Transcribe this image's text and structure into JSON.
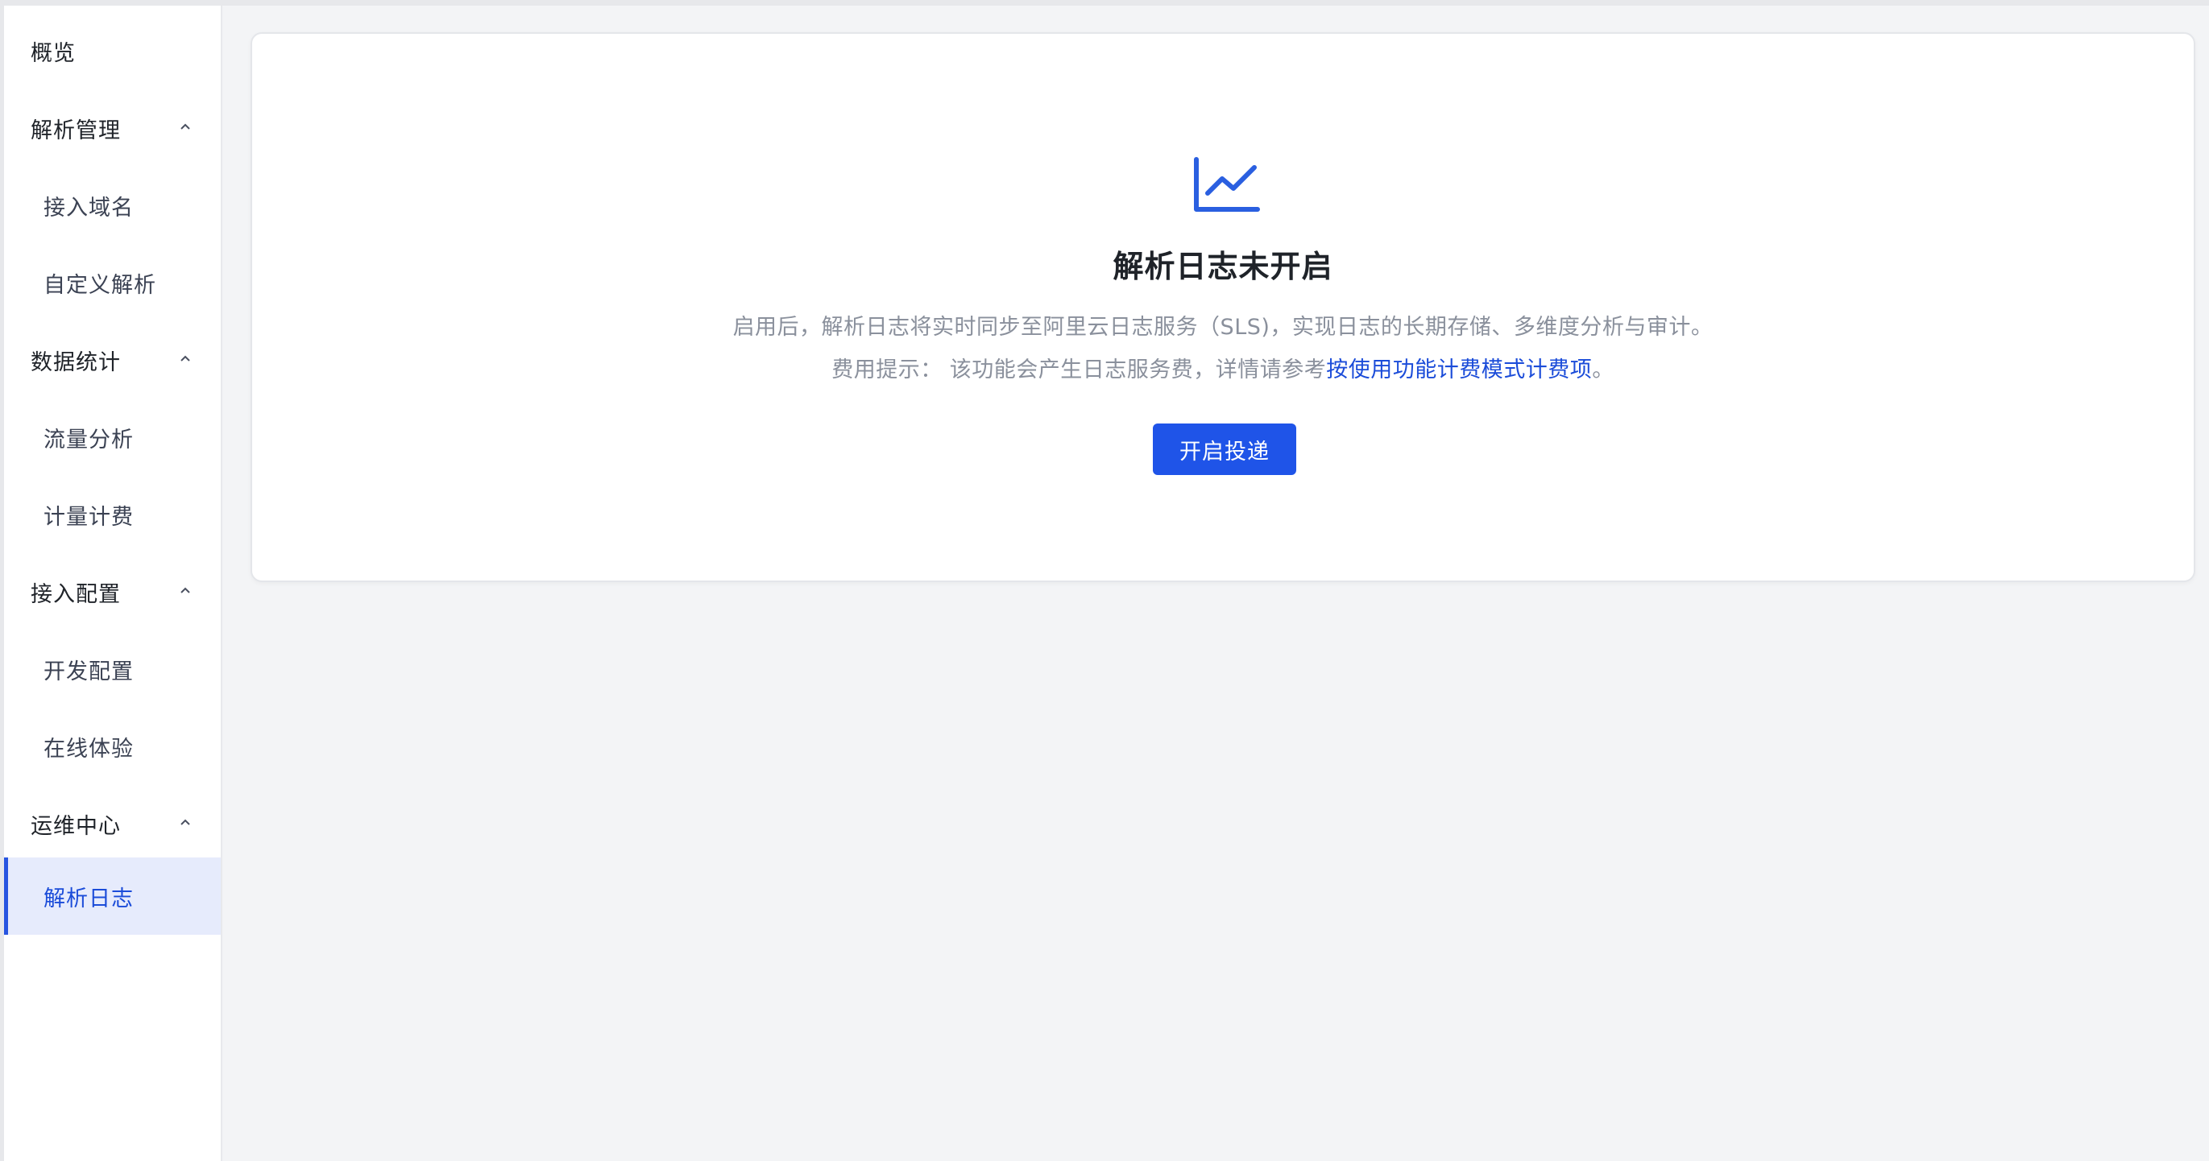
{
  "sidebar": {
    "items": [
      {
        "label": "概览",
        "type": "group",
        "has_chevron": false
      },
      {
        "label": "解析管理",
        "type": "group",
        "has_chevron": true
      },
      {
        "label": "接入域名",
        "type": "sub"
      },
      {
        "label": "自定义解析",
        "type": "sub"
      },
      {
        "label": "数据统计",
        "type": "group",
        "has_chevron": true
      },
      {
        "label": "流量分析",
        "type": "sub"
      },
      {
        "label": "计量计费",
        "type": "sub"
      },
      {
        "label": "接入配置",
        "type": "group",
        "has_chevron": true
      },
      {
        "label": "开发配置",
        "type": "sub"
      },
      {
        "label": "在线体验",
        "type": "sub"
      },
      {
        "label": "运维中心",
        "type": "group",
        "has_chevron": true
      },
      {
        "label": "解析日志",
        "type": "sub",
        "active": true
      }
    ]
  },
  "empty_state": {
    "icon": "line-chart-icon",
    "title": "解析日志未开启",
    "description": "启用后，解析日志将实时同步至阿里云日志服务（SLS)，实现日志的长期存储、多维度分析与审计。",
    "tip_prefix": "费用提示：  该功能会产生日志服务费，详情请参考",
    "tip_link": "按使用功能计费模式计费项",
    "tip_suffix": "。",
    "button_label": "开启投递"
  },
  "colors": {
    "accent": "#1f54e8",
    "link": "#1b4cd9",
    "active_bg": "#e6ebfc",
    "page_bg": "#f3f4f6",
    "muted_text": "#8a909c"
  }
}
